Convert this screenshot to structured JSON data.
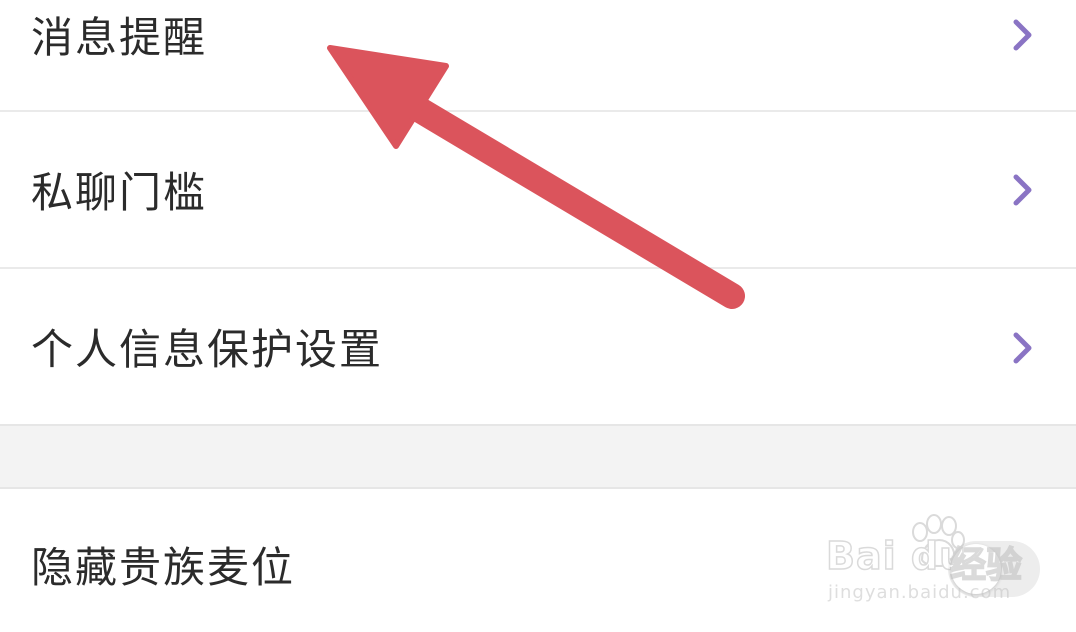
{
  "settings": {
    "items": [
      {
        "label": "消息提醒"
      },
      {
        "label": "私聊门槛"
      },
      {
        "label": "个人信息保护设置"
      },
      {
        "label": "隐藏贵族麦位"
      }
    ]
  },
  "toggle": {
    "checked": false
  },
  "arrow": {
    "color": "#db545c"
  },
  "accent_color": "#8a74c4",
  "watermark": {
    "brand": "Bai du",
    "suffix": "经验",
    "url": "jingyan.baidu.com"
  }
}
